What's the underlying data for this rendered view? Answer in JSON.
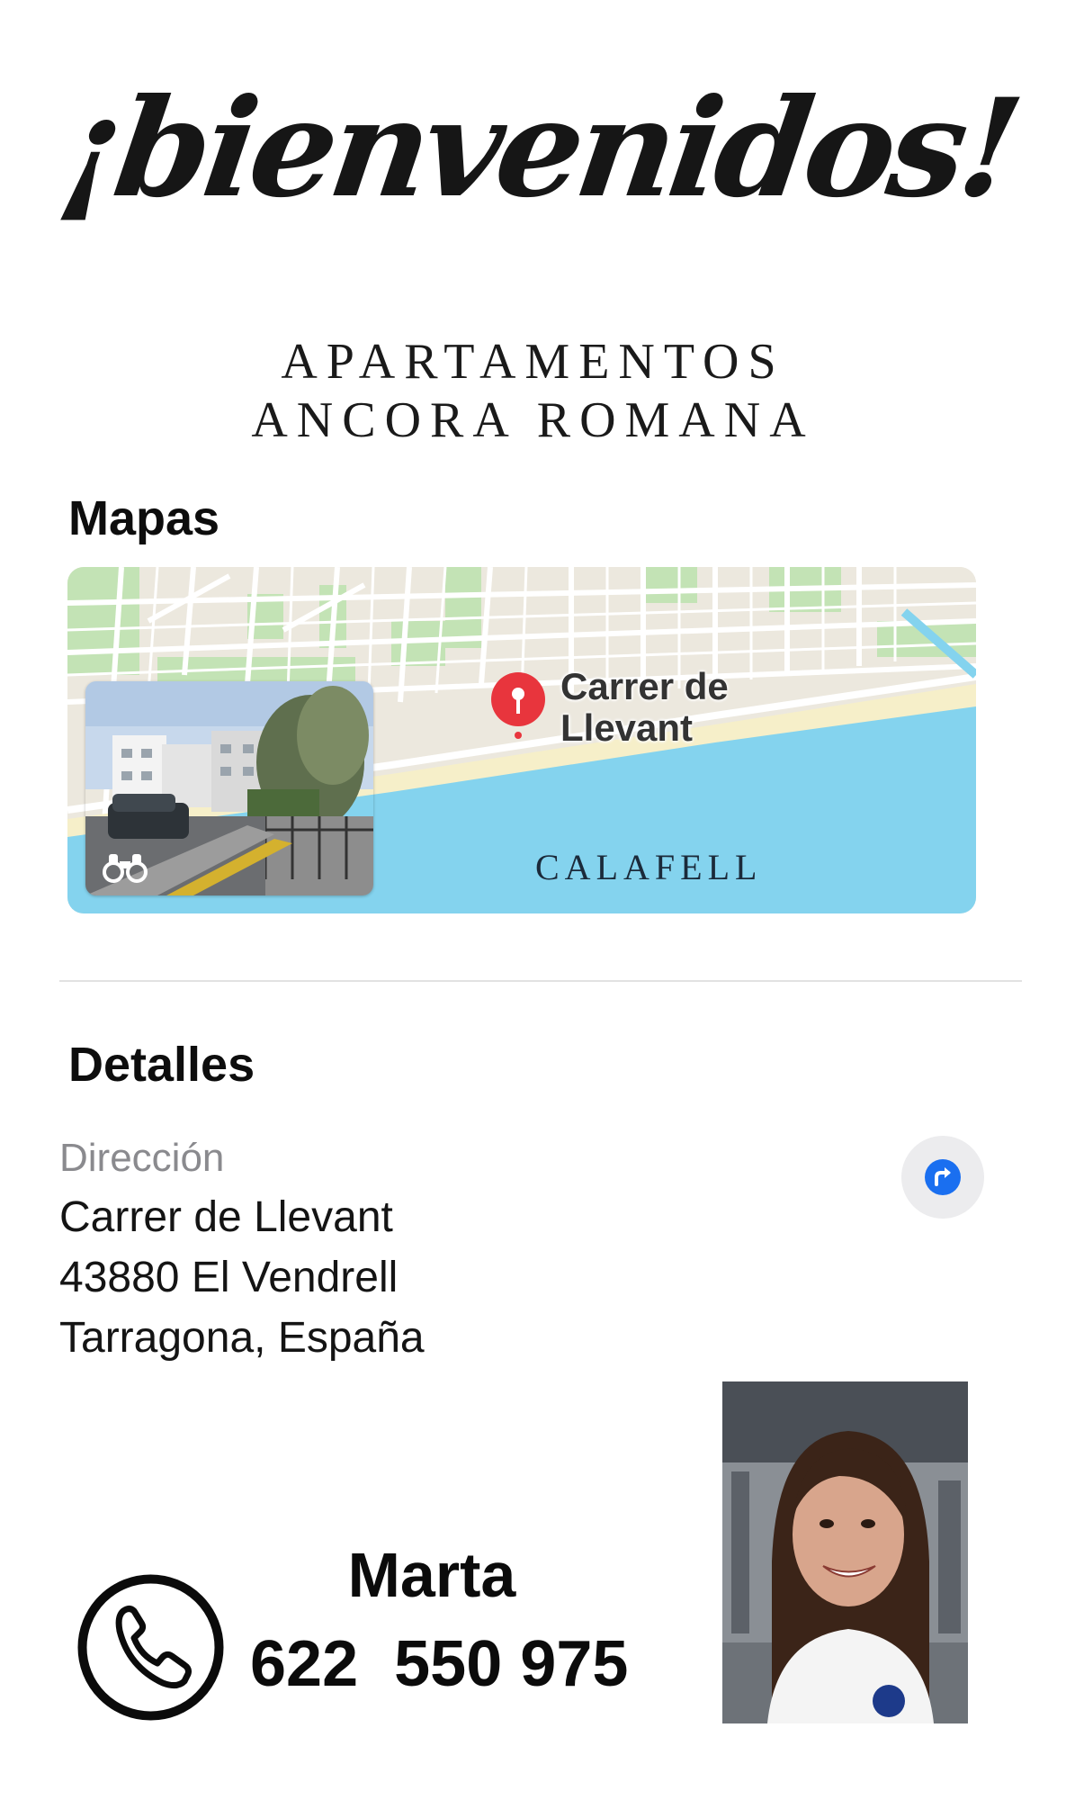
{
  "header": {
    "welcome": "¡bienvenidos!",
    "subtitle_line1": "APARTAMENTOS",
    "subtitle_line2": "ANCORA ROMANA"
  },
  "maps_section": {
    "title": "Mapas",
    "pin_label_line1": "Carrer de",
    "pin_label_line2": "Llevant",
    "city_label": "CALAFELL"
  },
  "details_section": {
    "title": "Detalles",
    "address_label": "Dirección",
    "address_lines": [
      "Carrer de Llevant",
      "43880 El Vendrell",
      "Tarragona, España"
    ]
  },
  "contact": {
    "name": "Marta",
    "phone": "622  550 975"
  },
  "icons": {
    "directions": "directions-arrow-icon",
    "phone": "phone-handset-icon",
    "map_pin": "map-pin-icon",
    "look_around": "binoculars-icon"
  },
  "colors": {
    "accent_blue": "#1a6ff0",
    "pin_red": "#e8353d",
    "water": "#84d3ee",
    "beach": "#f6efc9",
    "park": "#c3e3b5"
  }
}
